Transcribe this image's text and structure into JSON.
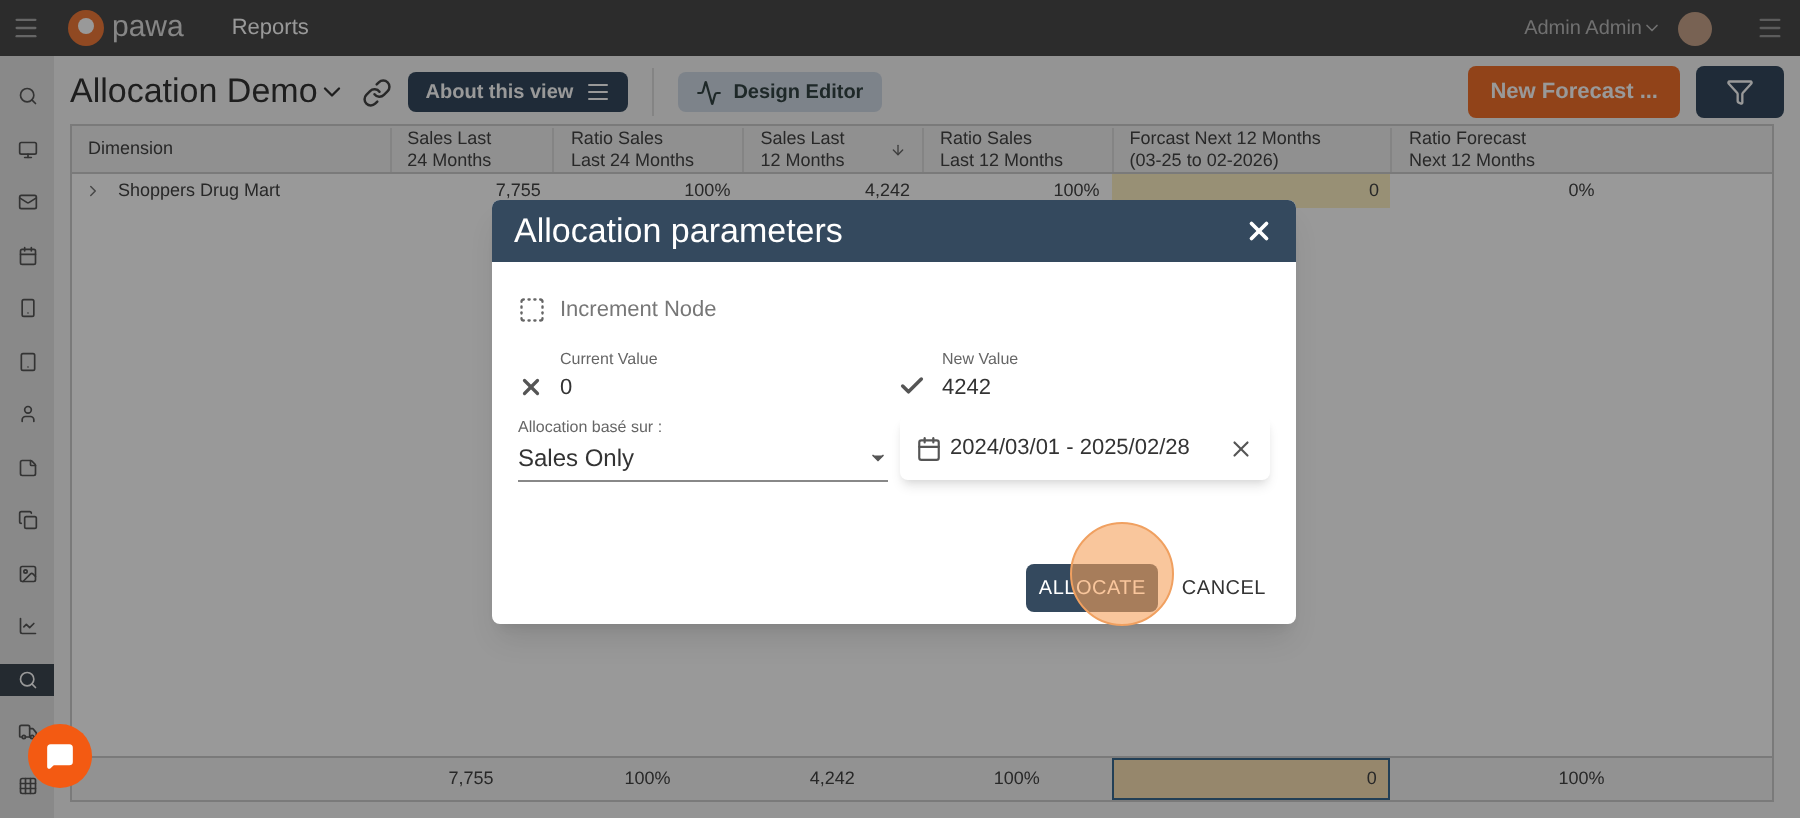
{
  "header": {
    "logo": "pawa",
    "nav": [
      {
        "label": "Reports"
      }
    ],
    "user": "Admin Admin"
  },
  "sidebar": {
    "items": [
      {
        "selected": false
      },
      {
        "selected": false
      },
      {
        "selected": false
      },
      {
        "selected": false
      },
      {
        "selected": false
      },
      {
        "selected": false
      },
      {
        "selected": false
      },
      {
        "selected": false
      },
      {
        "selected": false
      },
      {
        "selected": false
      },
      {
        "selected": false
      },
      {
        "selected": true
      },
      {
        "selected": false
      },
      {
        "selected": false
      }
    ]
  },
  "toolbar": {
    "title": "Allocation Demo",
    "about_button": "About this view",
    "design_button": "Design Editor",
    "new_forecast_button": "New Forecast ..."
  },
  "table": {
    "columns": [
      {
        "lines": [
          "Dimension"
        ],
        "sorted": false
      },
      {
        "lines": [
          "Sales Last",
          "24 Months"
        ],
        "sorted": false
      },
      {
        "lines": [
          "Ratio Sales",
          "Last 24 Months"
        ],
        "sorted": false
      },
      {
        "lines": [
          "Sales Last",
          "12 Months"
        ],
        "sorted": true
      },
      {
        "lines": [
          "Ratio Sales",
          "Last 12 Months"
        ],
        "sorted": false
      },
      {
        "lines": [
          "Forcast Next 12 Months",
          "(03-25 to 02-2026)"
        ],
        "sorted": false
      },
      {
        "lines": [
          "Ratio Forecast",
          "Next 12 Months"
        ],
        "sorted": false
      }
    ],
    "rows": [
      {
        "expanded": false,
        "cells": [
          "Shoppers Drug Mart",
          "7,755",
          "100%",
          "4,242",
          "100%",
          "0",
          "0%"
        ]
      }
    ],
    "totals": [
      "7,755",
      "100%",
      "4,242",
      "100%",
      "0",
      "100%"
    ]
  },
  "dialog": {
    "title": "Allocation parameters",
    "node_label": "Increment Node",
    "current": {
      "label": "Current Value",
      "value": "0"
    },
    "new": {
      "label": "New Value",
      "value": "4242"
    },
    "select": {
      "label": "Allocation basé sur :",
      "value": "Sales Only"
    },
    "date_range": "2024/03/01 - 2025/02/28",
    "buttons": [
      "ALLOCATE",
      "CANCEL"
    ]
  }
}
